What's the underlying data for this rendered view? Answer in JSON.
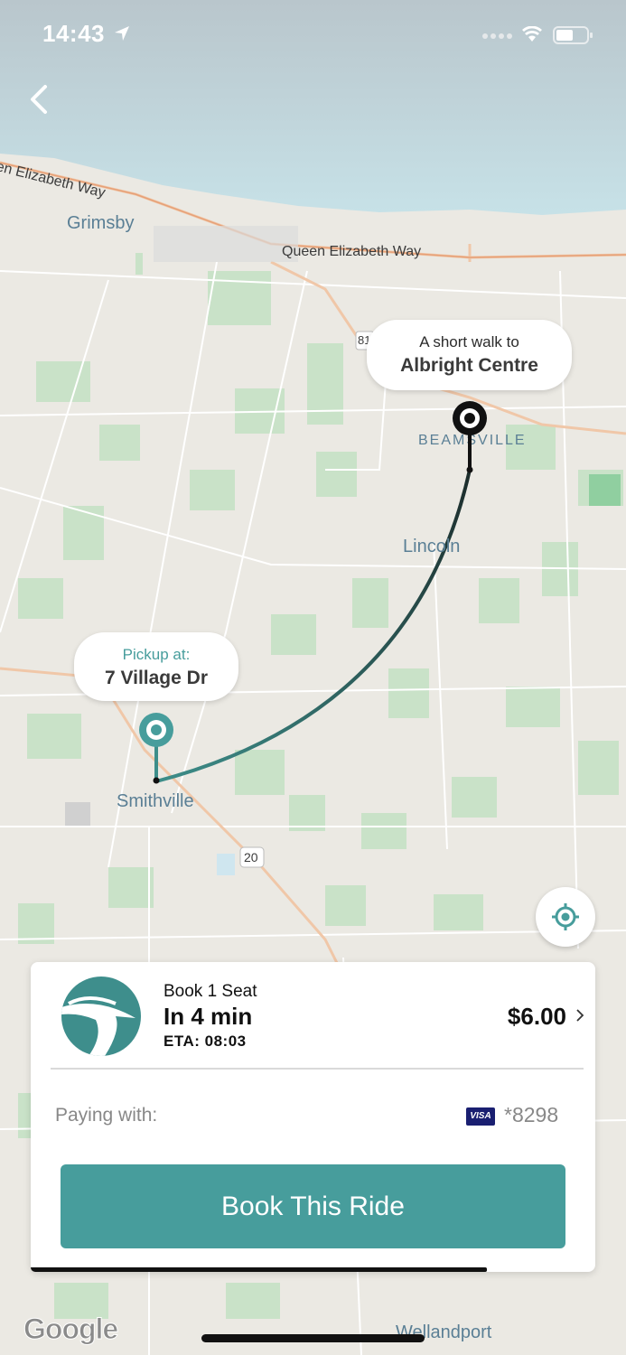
{
  "status_bar": {
    "time": "14:43"
  },
  "map": {
    "places": {
      "grimsby": "Grimsby",
      "beamsville": "BEAMSVILLE",
      "lincoln": "Lincoln",
      "smithville": "Smithville",
      "wellandport": "Wellandport"
    },
    "roads": {
      "qew_left": "en Elizabeth Way",
      "qew_right": "Queen Elizabeth Way",
      "route_81": "81",
      "route_20": "20"
    },
    "dropoff_bubble": {
      "line1": "A short walk to",
      "line2": "Albright Centre"
    },
    "pickup_bubble": {
      "line1": "Pickup at:",
      "line2": "7 Village Dr"
    },
    "attribution": "Google"
  },
  "booking_card": {
    "seat_label": "Book 1 Seat",
    "eta_main": "In 4 min",
    "eta_sub": "ETA: 08:03",
    "price": "$6.00",
    "paying_label": "Paying with:",
    "card_brand": "VISA",
    "card_number": "*8298",
    "book_button": "Book This Ride"
  },
  "colors": {
    "accent": "#479d9c",
    "route_dark": "#1f3d3a"
  }
}
